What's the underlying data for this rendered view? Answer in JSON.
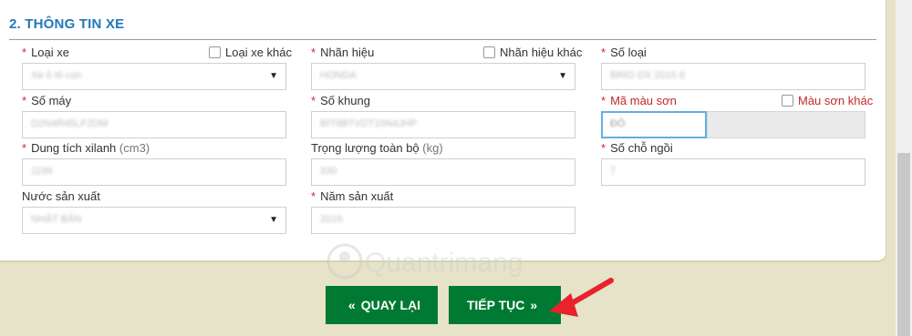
{
  "section_title": "2. THÔNG TIN XE",
  "fields": {
    "loai_xe": {
      "label": "Loại xe",
      "required": "*",
      "value": "Xe ô tô con",
      "checkbox": "Loại xe khác"
    },
    "nhan_hieu": {
      "label": "Nhãn hiệu",
      "required": "*",
      "value": "HONDA",
      "checkbox": "Nhãn hiệu khác"
    },
    "so_loai": {
      "label": "Số loại",
      "required": "*",
      "value": "BRIO DX 2015 E"
    },
    "so_may": {
      "label": "Số máy",
      "required": "*",
      "value": "D2N4R45LF2DM"
    },
    "so_khung": {
      "label": "Số khung",
      "required": "*",
      "value": "BIT8BTVDT15N4JHP"
    },
    "ma_mau_son": {
      "label": "Mã màu sơn",
      "required": "*",
      "value": "ĐỎ",
      "checkbox": "Màu sơn khác"
    },
    "dung_tich": {
      "label": "Dung tích xilanh",
      "unit": "(cm3)",
      "required": "*",
      "value": "1199"
    },
    "trong_luong": {
      "label": "Trọng lượng toàn bộ",
      "unit": "(kg)",
      "value": "330"
    },
    "so_cho": {
      "label": "Số chỗ ngồi",
      "required": "*",
      "value": "7"
    },
    "nuoc_san_xuat": {
      "label": "Nước sản xuất",
      "value": "NHẬT BẢN"
    },
    "nam_san_xuat": {
      "label": "Năm sản xuất",
      "required": "*",
      "value": "2015"
    }
  },
  "buttons": {
    "back": {
      "label": "QUAY LẠI",
      "icon": "«"
    },
    "next": {
      "label": "TIẾP TỤC",
      "icon": "»"
    }
  },
  "watermark_text": "Quantrimang",
  "colors": {
    "accent_blue": "#2378b9",
    "button_green": "#007a33",
    "required_red": "#d9232d",
    "arrow_red": "#e8232b",
    "page_bg": "#e6e3c8"
  }
}
